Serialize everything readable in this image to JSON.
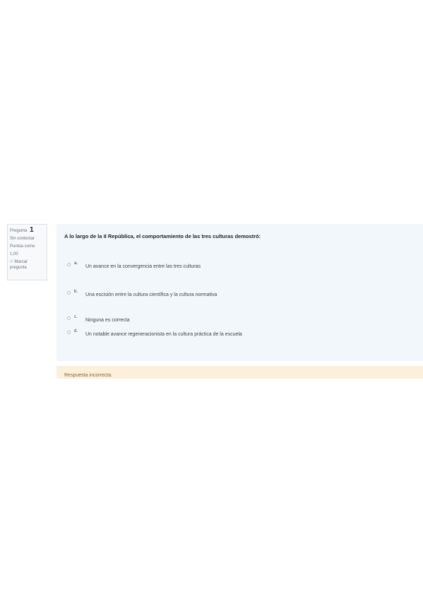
{
  "question_info": {
    "label": "Pregunta",
    "number": "1",
    "status": "Sin contestar",
    "score_label": "Puntúa como",
    "score_value": "1,00",
    "flag_label": "Marcar pregunta"
  },
  "question": {
    "text": "A lo largo de la II República, el comportamiento de las tres culturas demostró:",
    "answers": [
      {
        "letter": "a.",
        "text": "Un avance en la convergencia entre las tres culturas"
      },
      {
        "letter": "b.",
        "text": "Una escisión entre la cultura científica y la cultura normativa"
      },
      {
        "letter": "c.",
        "text": "Ninguna es correcta"
      },
      {
        "letter": "d.",
        "text": "Un notable avance regeneracionista en la cultura práctica de la escuela"
      }
    ]
  },
  "feedback": {
    "text": "Respuesta incorrecta."
  },
  "icons": {
    "flag": "flag-icon",
    "radio": "radio-button-icon"
  },
  "colors": {
    "content_background": "#f2f7fb",
    "feedback_background": "#fcefdc",
    "feedback_text": "#8e662e"
  }
}
